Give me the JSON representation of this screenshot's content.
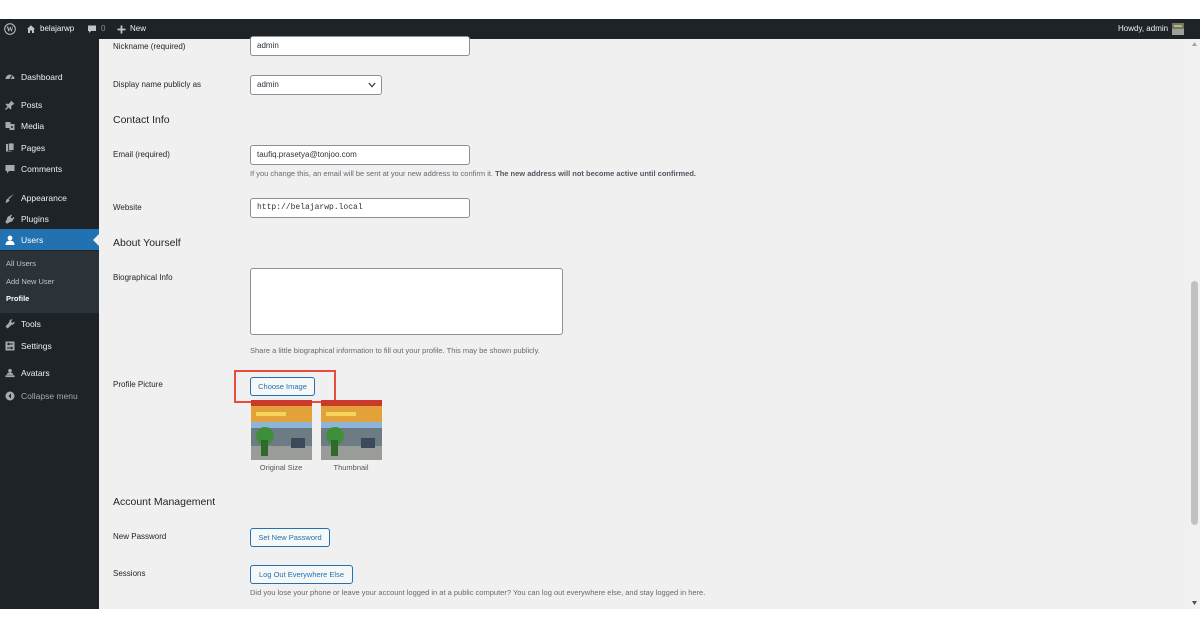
{
  "adminbar": {
    "site_name": "belajarwp",
    "comments_count": "0",
    "new_label": "New",
    "howdy": "Howdy, admin"
  },
  "sidebar": {
    "items": [
      {
        "label": "Dashboard",
        "icon": "dashboard-icon"
      },
      {
        "label": "Posts",
        "icon": "pushpin-icon"
      },
      {
        "label": "Media",
        "icon": "media-icon"
      },
      {
        "label": "Pages",
        "icon": "pages-icon"
      },
      {
        "label": "Comments",
        "icon": "comment-icon"
      },
      {
        "label": "Appearance",
        "icon": "brush-icon"
      },
      {
        "label": "Plugins",
        "icon": "plug-icon"
      },
      {
        "label": "Users",
        "icon": "user-icon"
      },
      {
        "label": "Tools",
        "icon": "wrench-icon"
      },
      {
        "label": "Settings",
        "icon": "settings-icon"
      },
      {
        "label": "Avatars",
        "icon": "avatars-icon"
      },
      {
        "label": "Collapse menu",
        "icon": "collapse-icon"
      }
    ],
    "users_submenu": [
      "All Users",
      "Add New User",
      "Profile"
    ],
    "active_item": "Users",
    "current_submenu": "Profile"
  },
  "form": {
    "nickname": {
      "label": "Nickname (required)",
      "value": "admin"
    },
    "display_name": {
      "label": "Display name publicly as",
      "value": "admin"
    },
    "contact_heading": "Contact Info",
    "email": {
      "label": "Email (required)",
      "value": "taufiq.prasetya@tonjoo.com",
      "note": "If you change this, an email will be sent at your new address to confirm it.",
      "note_bold": "The new address will not become active until confirmed."
    },
    "website": {
      "label": "Website",
      "value": "http://belajarwp.local"
    },
    "about_heading": "About Yourself",
    "bio": {
      "label": "Biographical Info",
      "value": "",
      "note": "Share a little biographical information to fill out your profile. This may be shown publicly."
    },
    "profile_picture": {
      "label": "Profile Picture",
      "button": "Choose Image",
      "captions": [
        "Original Size",
        "Thumbnail"
      ],
      "highlight_color": "#e74c3c"
    },
    "account_heading": "Account Management",
    "new_password": {
      "label": "New Password",
      "button": "Set New Password"
    },
    "sessions": {
      "label": "Sessions",
      "button": "Log Out Everywhere Else",
      "note": "Did you lose your phone or leave your account logged in at a public computer? You can log out everywhere else, and stay logged in here."
    }
  },
  "colors": {
    "admin_bar": "#1d2327",
    "accent": "#2271b1",
    "background": "#f0f0f1"
  }
}
